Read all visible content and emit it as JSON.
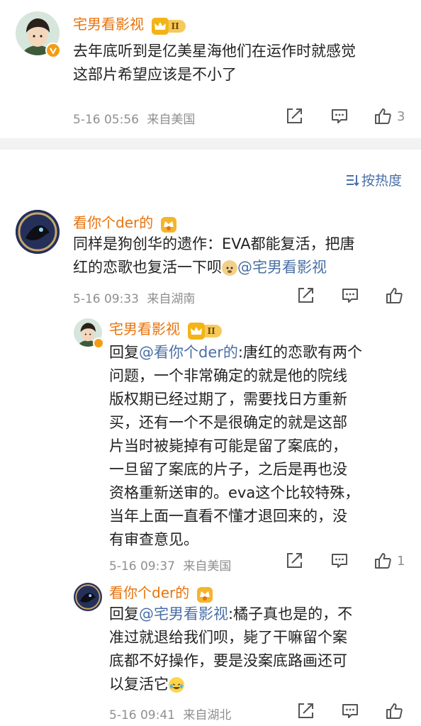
{
  "comments": {
    "c1": {
      "user": "宅男看影视",
      "level": "II",
      "text_line1": "去年底听到是亿美星海他们在运作时就感觉",
      "text_line2": "这部片希望应该是不小了",
      "time": "5-16 05:56",
      "location": "来自美国",
      "likes": "3"
    },
    "sort_label": "按热度",
    "c2": {
      "user": "看你个der的",
      "text_line1": "同样是狗创华的遗作：EVA都能复活，把唐",
      "text_line2": "红的恋歌也复活一下呗",
      "mention": "@宅男看影视",
      "time": "5-16 09:33",
      "location": "来自湖南",
      "likes": ""
    },
    "r1": {
      "user": "宅男看影视",
      "level": "II",
      "reply_prefix": "回复",
      "mention": "@看你个der的",
      "text_first": ":唐红的恋歌有两个",
      "lines": [
        "问题，一个非常确定的就是他的院线",
        "版权期已经过期了，需要找日方重新",
        "买，还有一个不是很确定的就是这部",
        "片当时被毙掉有可能是留了案底的，",
        "一旦留了案底的片子，之后是再也没",
        "资格重新送审的。eva这个比较特殊，",
        "当年上面一直看不懂才退回来的，没",
        "有审查意见。"
      ],
      "time": "5-16 09:37",
      "location": "来自美国",
      "likes": "1"
    },
    "r2": {
      "user": "看你个der的",
      "reply_prefix": "回复",
      "mention": "@宅男看影视",
      "text_first": ":橘子真也是的，不",
      "lines": [
        "准过就退给我们呗，毙了干嘛留个案",
        "底都不好操作，要是没案底路画还可",
        "以复活它"
      ],
      "time": "5-16 09:41",
      "location": "来自湖北",
      "likes": ""
    }
  },
  "colors": {
    "username": "#e8730d",
    "mention": "#4a6fa5",
    "meta": "#8f8f8f",
    "divider": "#f2f2f2"
  },
  "icons": [
    "share-icon",
    "comment-icon",
    "like-icon",
    "sort-icon",
    "vip-crown-icon",
    "fan-medal-icon",
    "verified-badge-icon",
    "doge-emoji-icon",
    "laugh-cry-emoji-icon"
  ]
}
